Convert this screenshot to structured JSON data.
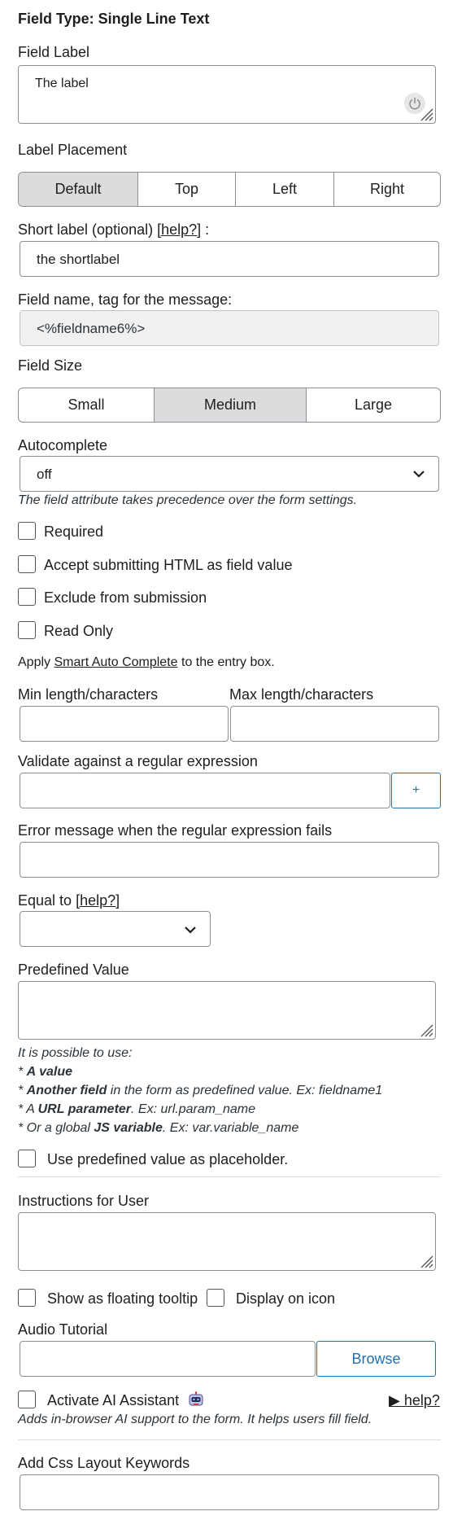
{
  "header": {
    "field_type": "Field Type: Single Line Text"
  },
  "field_label": {
    "label": "Field Label",
    "value": "The label",
    "reset_icon": "power-icon"
  },
  "label_placement": {
    "label": "Label Placement",
    "options": [
      "Default",
      "Top",
      "Left",
      "Right"
    ],
    "selected": "Default"
  },
  "short_label": {
    "label_prefix": "Short label (optional) ",
    "help": "[help?]",
    "label_suffix": " :",
    "value": "the shortlabel"
  },
  "field_name": {
    "label": "Field name, tag for the message:",
    "value": "<%fieldname6%>"
  },
  "field_size": {
    "label": "Field Size",
    "options": [
      "Small",
      "Medium",
      "Large"
    ],
    "selected": "Medium"
  },
  "autocomplete": {
    "label": "Autocomplete",
    "value": "off",
    "hint": "The field attribute takes precedence over the form settings."
  },
  "checkboxes": {
    "required": "Required",
    "accept_html": "Accept submitting HTML as field value",
    "exclude": "Exclude from submission",
    "read_only": "Read Only"
  },
  "smart_auto": {
    "prefix": "Apply ",
    "link": "Smart Auto Complete",
    "suffix": " to the entry box."
  },
  "length": {
    "min_label": "Min length/characters",
    "max_label": "Max length/characters"
  },
  "regex": {
    "label": "Validate against a regular expression",
    "add_button": "+"
  },
  "regex_error": {
    "label": "Error message when the regular expression fails"
  },
  "equal_to": {
    "label": "Equal to ",
    "help": "[help?]"
  },
  "predefined": {
    "label": "Predefined Value",
    "hint_intro": "It is possible to use:",
    "line1_prefix": "* ",
    "line1_bold": "A value",
    "line2_prefix": "* ",
    "line2_bold": "Another field",
    "line2_rest": " in the form as predefined value. Ex: fieldname1",
    "line3_prefix": "* A ",
    "line3_bold": "URL parameter",
    "line3_rest": ". Ex: url.param_name",
    "line4_prefix": "* Or a global ",
    "line4_bold": "JS variable",
    "line4_rest": ". Ex: var.variable_name",
    "as_placeholder": "Use predefined value as placeholder."
  },
  "instructions": {
    "label": "Instructions for User",
    "floating_tooltip": "Show as floating tooltip",
    "display_on_icon": "Display on icon"
  },
  "audio": {
    "label": "Audio Tutorial",
    "browse": "Browse"
  },
  "ai": {
    "label": "Activate AI Assistant",
    "help": "▶ help?",
    "hint": "Adds in-browser AI support to the form. It helps users fill field.",
    "icon": "robot-icon"
  },
  "css": {
    "label": "Add Css Layout Keywords"
  }
}
